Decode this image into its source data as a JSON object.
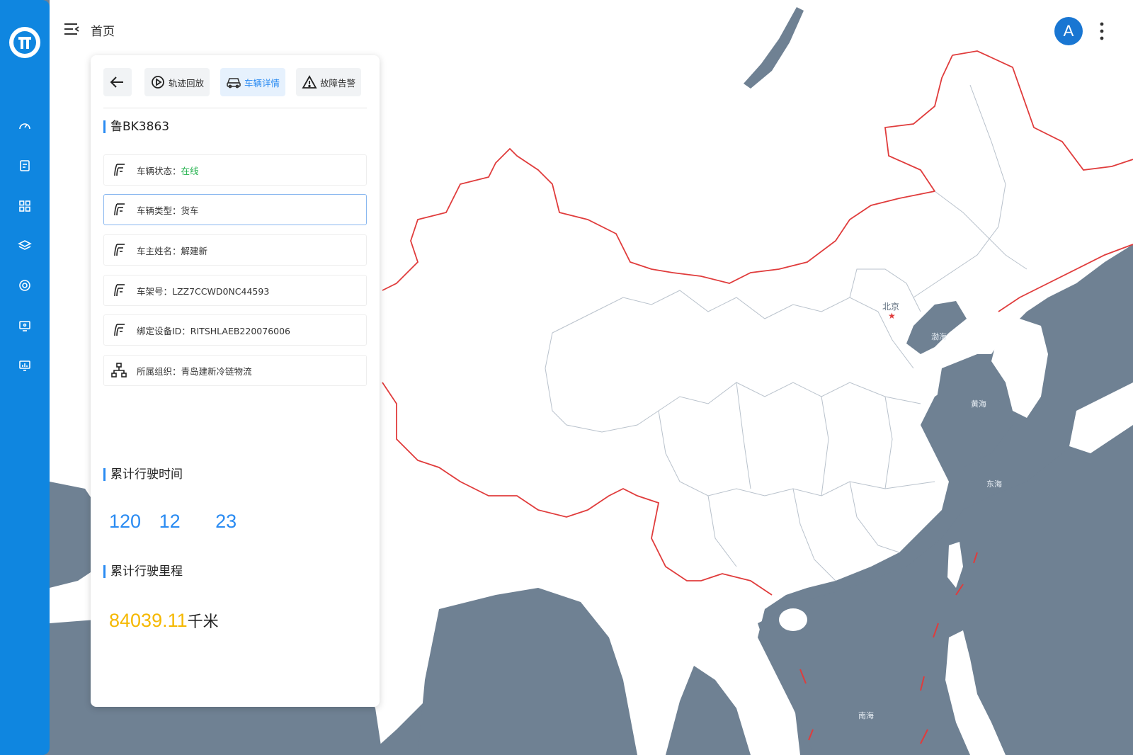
{
  "header": {
    "breadcrumb": "首页",
    "avatar_letter": "A"
  },
  "sidebar": {
    "items": [
      {
        "icon": "gauge-icon"
      },
      {
        "icon": "document-icon"
      },
      {
        "icon": "apps-grid-icon"
      },
      {
        "icon": "layers-icon"
      },
      {
        "icon": "target-icon"
      },
      {
        "icon": "monitor-icon"
      },
      {
        "icon": "chart-screen-icon"
      }
    ]
  },
  "panel": {
    "tabs": [
      {
        "label": "轨迹回放",
        "icon": "playback-icon"
      },
      {
        "label": "车辆详情",
        "icon": "car-icon",
        "active": true
      },
      {
        "label": "故障告警",
        "icon": "warning-icon"
      }
    ],
    "plate": "鲁BK3863",
    "info": {
      "status_label": "车辆状态：",
      "status_value": "在线",
      "type": "车辆类型：货车",
      "owner": "车主姓名：解建新",
      "vin": "车架号：LZZ7CCWD0NC44593",
      "device": "绑定设备ID：RITSHLAEB220076006",
      "org": "所属组织：青岛建新冷链物流"
    },
    "drive_time": {
      "title": "累计行驶时间",
      "values": [
        "120",
        "12",
        "23"
      ]
    },
    "mileage": {
      "title": "累计行驶里程",
      "value": "84039.11",
      "unit": "千米"
    }
  },
  "map": {
    "labels": [
      "北京",
      "渤海",
      "黄海",
      "东海",
      "南海"
    ],
    "colors": {
      "water": "#6f8193",
      "land": "#ffffff",
      "border": "#e03c3c",
      "province": "#b9c2cc"
    }
  }
}
